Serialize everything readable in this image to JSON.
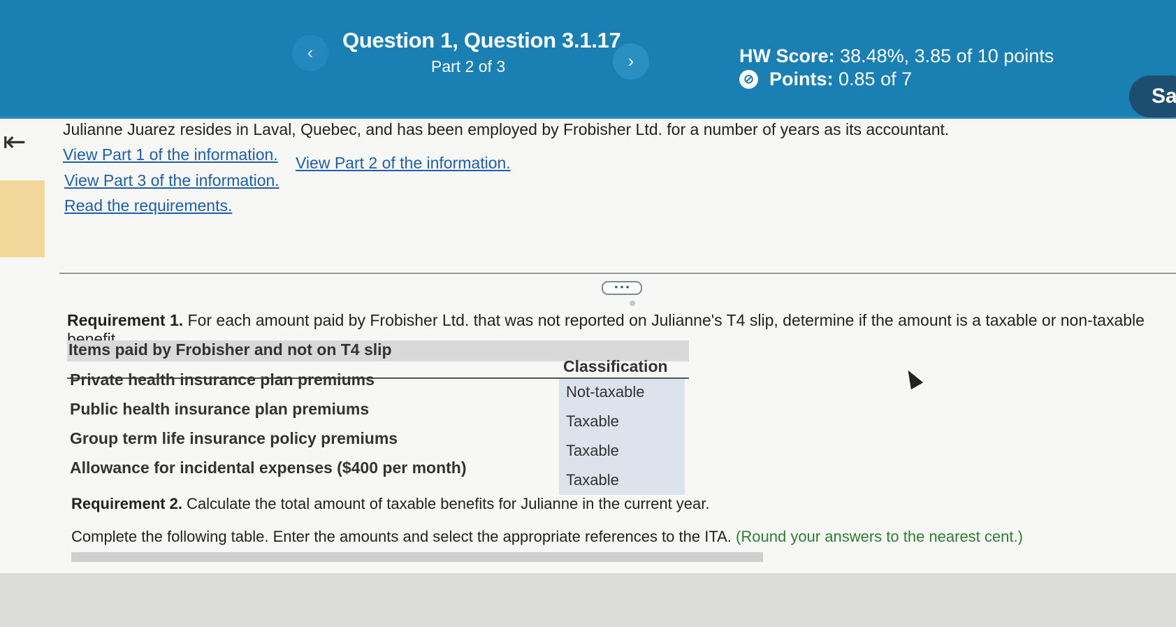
{
  "header": {
    "prev_icon": "‹",
    "next_icon": "›",
    "question_title": "Question 1, Question 3.1.17",
    "part": "Part 2 of 3",
    "hw_score_label": "HW Score:",
    "hw_score_value": "38.48%, 3.85 of 10 points",
    "points_label": "Points:",
    "points_value": "0.85 of 7",
    "save_label": "Sa"
  },
  "sidebar": {
    "back_icon": "⇤"
  },
  "problem": {
    "intro": "Julianne Juarez resides in Laval, Quebec, and has been employed by Frobisher Ltd. for a number of years as its accountant.",
    "links": [
      "View Part 1 of the information.",
      "View Part 2 of the information.",
      "View Part 3 of the information.",
      "Read the requirements."
    ],
    "more_label": "• • •"
  },
  "requirement1": {
    "label": "Requirement 1.",
    "text": " For each amount paid by Frobisher Ltd. that was not reported on Julianne's T4 slip, determine if the amount is a taxable or non-taxable benefit.",
    "table": {
      "col_items": "Items paid by Frobisher and not on T4 slip",
      "col_classification": "Classification",
      "rows": [
        {
          "item": "Private health insurance plan premiums",
          "classification": "Not-taxable"
        },
        {
          "item": "Public health insurance plan premiums",
          "classification": "Taxable"
        },
        {
          "item": "Group term life insurance policy premiums",
          "classification": "Taxable"
        },
        {
          "item": "Allowance for incidental expenses ($400 per month)",
          "classification": "Taxable"
        }
      ]
    }
  },
  "requirement2": {
    "label": "Requirement 2.",
    "text": " Calculate the total amount of taxable benefits for Julianne in the current year.",
    "instruction": "Complete the following table. Enter the amounts and select the appropriate references to the ITA.",
    "instruction_note": "(Round your answers to the nearest cent.)"
  },
  "colors": {
    "header_bg": "#1a7fb3",
    "link": "#1f5fa8",
    "note_green": "#2e7d32",
    "save_bg": "#1d4e6e"
  }
}
